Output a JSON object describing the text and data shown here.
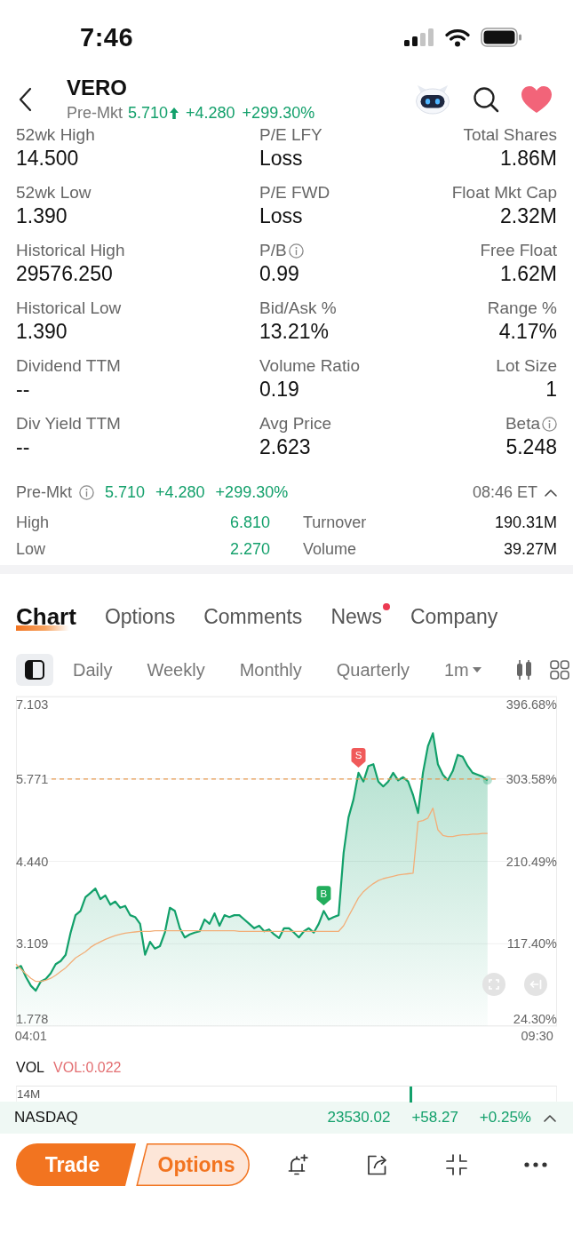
{
  "status_bar": {
    "time": "7:46"
  },
  "header": {
    "title": "VERO",
    "session": "Pre-Mkt",
    "price": "5.710",
    "rising": true,
    "change": "+4.280",
    "change_pct": "+299.30%",
    "watchlisted": true
  },
  "stats": [
    {
      "label": "52wk High",
      "value": "14.500",
      "info": false
    },
    {
      "label": "P/E LFY",
      "value": "Loss",
      "info": false
    },
    {
      "label": "Total Shares",
      "value": "1.86M",
      "info": false
    },
    {
      "label": "52wk Low",
      "value": "1.390",
      "info": false
    },
    {
      "label": "P/E FWD",
      "value": "Loss",
      "info": false
    },
    {
      "label": "Float Mkt Cap",
      "value": "2.32M",
      "info": false
    },
    {
      "label": "Historical High",
      "value": "29576.250",
      "info": false
    },
    {
      "label": "P/B",
      "value": "0.99",
      "info": true
    },
    {
      "label": "Free Float",
      "value": "1.62M",
      "info": false
    },
    {
      "label": "Historical Low",
      "value": "1.390",
      "info": false
    },
    {
      "label": "Bid/Ask %",
      "value": "13.21%",
      "info": false
    },
    {
      "label": "Range %",
      "value": "4.17%",
      "info": false
    },
    {
      "label": "Dividend TTM",
      "value": "--",
      "info": false
    },
    {
      "label": "Volume Ratio",
      "value": "0.19",
      "info": false
    },
    {
      "label": "Lot Size",
      "value": "1",
      "info": false
    },
    {
      "label": "Div Yield TTM",
      "value": "--",
      "info": false
    },
    {
      "label": "Avg Price",
      "value": "2.623",
      "info": false
    },
    {
      "label": "Beta",
      "value": "5.248",
      "info": true
    }
  ],
  "pre_market": {
    "label": "Pre-Mkt",
    "info": true,
    "price": "5.710",
    "change": "+4.280",
    "change_pct": "+299.30%",
    "rising": true,
    "time": "08:46 ET",
    "rows": [
      {
        "label": "High",
        "value": "6.810",
        "kind": "price"
      },
      {
        "label": "Turnover",
        "value": "190.31M",
        "kind": "amount"
      },
      {
        "label": "Low",
        "value": "2.270",
        "kind": "price"
      },
      {
        "label": "Volume",
        "value": "39.27M",
        "kind": "amount"
      }
    ]
  },
  "tabs": [
    {
      "label": "Chart",
      "selected": true,
      "unread": false
    },
    {
      "label": "Options",
      "selected": false,
      "unread": false
    },
    {
      "label": "Comments",
      "selected": false,
      "unread": false
    },
    {
      "label": "News",
      "selected": false,
      "unread": true
    },
    {
      "label": "Company",
      "selected": false,
      "unread": false
    }
  ],
  "periods": [
    {
      "label": "Daily",
      "kind": "period",
      "selected": false
    },
    {
      "label": "Weekly",
      "kind": "period",
      "selected": false
    },
    {
      "label": "Monthly",
      "kind": "period",
      "selected": false
    },
    {
      "label": "Quarterly",
      "kind": "period",
      "selected": false
    },
    {
      "label": "1m",
      "kind": "dropdown",
      "selected": false
    }
  ],
  "chart": {
    "right_labels": [
      "396.68%",
      "303.58%",
      "210.49%",
      "117.40%",
      "24.30%"
    ],
    "chart_data": {
      "type": "area",
      "grid": true,
      "categories": [
        null,
        null,
        null,
        "04:01",
        null,
        null,
        null,
        null,
        null,
        null,
        null,
        null,
        null,
        null,
        null,
        null,
        null,
        null,
        null,
        null,
        null,
        null,
        null,
        null,
        null,
        null,
        null,
        null,
        null,
        null,
        null,
        null,
        null,
        null,
        null,
        null,
        null,
        null,
        null,
        null,
        null,
        null,
        null,
        null,
        null,
        null,
        null,
        null,
        null,
        null,
        null,
        null,
        null,
        null,
        null,
        null,
        null,
        null,
        null,
        null,
        null,
        null,
        null,
        null,
        null,
        null,
        null,
        null,
        null,
        null,
        null,
        null,
        null,
        null,
        null,
        null,
        null,
        null,
        null,
        null,
        null,
        null,
        null,
        null,
        null,
        null,
        null,
        null,
        null,
        null,
        null,
        null,
        null,
        null,
        null,
        null,
        null,
        null,
        null,
        null,
        null,
        null,
        null,
        null,
        null,
        "09:30",
        null,
        null,
        null,
        null
      ],
      "ylim": [
        1.778,
        7.103
      ],
      "yticks": [
        {
          "value": 7.103,
          "label": "7.103"
        },
        {
          "value": 5.771,
          "label": "5.771"
        },
        {
          "value": 4.44,
          "label": "4.440"
        },
        {
          "value": 3.109,
          "label": "3.109"
        },
        {
          "value": 1.778,
          "label": "1.778"
        }
      ],
      "series": [
        {
          "color": "#12a06a",
          "values": [
            2.71,
            2.75,
            2.57,
            2.43,
            2.35,
            2.5,
            2.54,
            2.63,
            2.78,
            2.83,
            2.93,
            3.29,
            3.57,
            3.64,
            3.86,
            3.93,
            4.0,
            3.83,
            3.89,
            3.74,
            3.79,
            3.69,
            3.72,
            3.57,
            3.54,
            3.43,
            2.93,
            3.14,
            3.03,
            3.07,
            3.29,
            3.69,
            3.64,
            3.36,
            3.21,
            3.26,
            3.29,
            3.31,
            3.5,
            3.43,
            3.6,
            3.4,
            3.57,
            3.54,
            3.57,
            3.57,
            3.5,
            3.43,
            3.36,
            3.4,
            3.31,
            3.34,
            3.26,
            3.2,
            3.36,
            3.36,
            3.29,
            3.21,
            3.31,
            3.36,
            3.29,
            3.43,
            3.64,
            3.5,
            3.54,
            3.57,
            4.58,
            5.15,
            5.44,
            5.87,
            5.73,
            5.98,
            6.01,
            5.73,
            5.65,
            5.73,
            5.87,
            5.75,
            5.8,
            5.73,
            5.51,
            5.22,
            5.87,
            6.3,
            6.51,
            6.01,
            5.84,
            5.75,
            5.9,
            6.16,
            6.13,
            5.98,
            5.87,
            5.84,
            5.81,
            5.75,
            null,
            null,
            null,
            null,
            null,
            null,
            null,
            null,
            null,
            null,
            null,
            null,
            null,
            null
          ]
        },
        {
          "type": "line",
          "color": "#f2ae78",
          "values": [
            2.78,
            2.7,
            2.62,
            2.55,
            2.5,
            2.5,
            2.52,
            2.55,
            2.6,
            2.66,
            2.72,
            2.8,
            2.88,
            2.93,
            2.98,
            3.05,
            3.1,
            3.14,
            3.18,
            3.21,
            3.24,
            3.26,
            3.28,
            3.29,
            3.3,
            3.31,
            3.31,
            3.31,
            3.32,
            3.32,
            3.32,
            3.32,
            3.32,
            3.32,
            3.32,
            3.32,
            3.32,
            3.32,
            3.32,
            3.32,
            3.32,
            3.32,
            3.32,
            3.32,
            3.32,
            3.31,
            3.31,
            3.31,
            3.31,
            3.31,
            3.31,
            3.31,
            3.31,
            3.31,
            3.31,
            3.31,
            3.31,
            3.31,
            3.31,
            3.31,
            3.31,
            3.31,
            3.31,
            3.31,
            3.31,
            3.31,
            3.4,
            3.55,
            3.7,
            3.85,
            3.95,
            4.02,
            4.08,
            4.13,
            4.16,
            4.18,
            4.2,
            4.22,
            4.23,
            4.24,
            4.25,
            5.08,
            5.1,
            5.14,
            5.3,
            4.95,
            4.86,
            4.84,
            4.84,
            4.86,
            4.87,
            4.87,
            4.88,
            4.88,
            4.89,
            4.89,
            null,
            null,
            null,
            null,
            null,
            null,
            null,
            null,
            null,
            null,
            null,
            null,
            null,
            null
          ]
        }
      ],
      "ref_lines": [
        {
          "axis": "y",
          "value": 5.771
        }
      ],
      "annotations": [
        "B",
        "S"
      ]
    }
  },
  "volume": {
    "label": "VOL",
    "reading": "VOL:0.022",
    "axis_label": "14M"
  },
  "index_bar": {
    "name": "NASDAQ",
    "price": "23530.02",
    "change": "+58.27",
    "change_pct": "+0.25%",
    "rising": true
  },
  "actions": [
    {
      "label": "Trade",
      "kind": "filled"
    },
    {
      "label": "Options",
      "kind": "outline"
    }
  ]
}
